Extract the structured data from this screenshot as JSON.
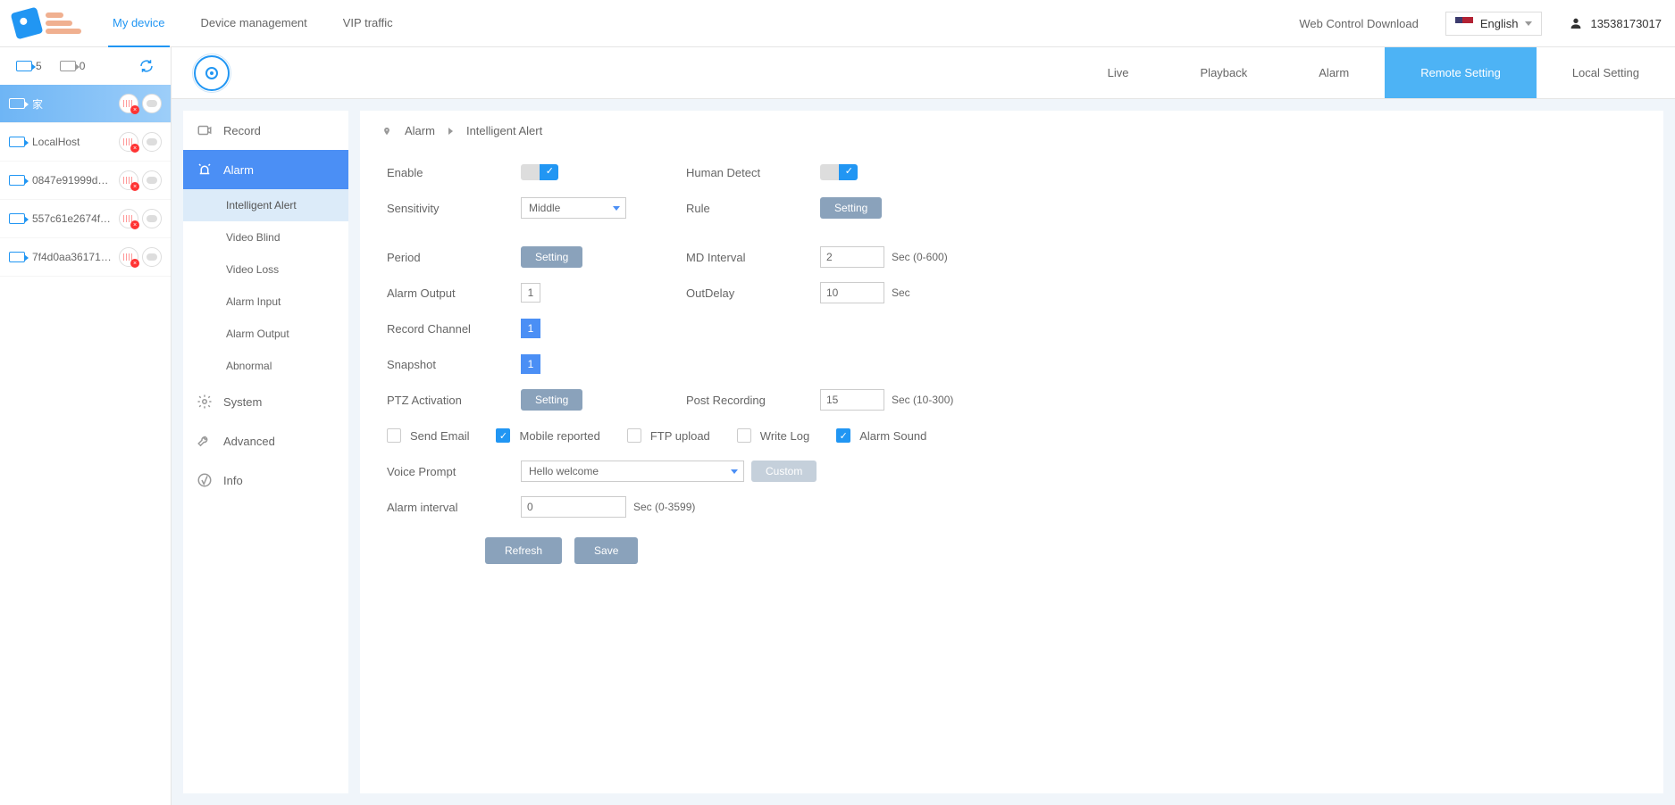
{
  "header": {
    "nav": {
      "my_device": "My device",
      "device_management": "Device management",
      "vip_traffic": "VIP traffic"
    },
    "web_control": "Web Control Download",
    "language": "English",
    "username": "13538173017"
  },
  "device_sidebar": {
    "count_on": "5",
    "count_off": "0",
    "devices": [
      {
        "name": "家"
      },
      {
        "name": "LocalHost"
      },
      {
        "name": "0847e91999d5..."
      },
      {
        "name": "557c61e2674ff..."
      },
      {
        "name": "7f4d0aa361710..."
      }
    ]
  },
  "sub_tabs": {
    "live": "Live",
    "playback": "Playback",
    "alarm": "Alarm",
    "remote_setting": "Remote Setting",
    "local_setting": "Local Setting"
  },
  "settings_nav": {
    "record": "Record",
    "alarm": "Alarm",
    "alarm_children": {
      "intelligent_alert": "Intelligent Alert",
      "video_blind": "Video Blind",
      "video_loss": "Video Loss",
      "alarm_input": "Alarm Input",
      "alarm_output": "Alarm Output",
      "abnormal": "Abnormal"
    },
    "system": "System",
    "advanced": "Advanced",
    "info": "Info"
  },
  "breadcrumb": {
    "alarm": "Alarm",
    "intelligent_alert": "Intelligent Alert"
  },
  "form": {
    "labels": {
      "enable": "Enable",
      "human_detect": "Human Detect",
      "sensitivity": "Sensitivity",
      "rule": "Rule",
      "period": "Period",
      "md_interval": "MD Interval",
      "alarm_output": "Alarm Output",
      "out_delay": "OutDelay",
      "record_channel": "Record Channel",
      "snapshot": "Snapshot",
      "ptz_activation": "PTZ Activation",
      "post_recording": "Post Recording",
      "voice_prompt": "Voice Prompt",
      "alarm_interval": "Alarm interval"
    },
    "values": {
      "sensitivity": "Middle",
      "md_interval": "2",
      "md_interval_suffix": "Sec (0-600)",
      "alarm_output_ch": "1",
      "out_delay": "10",
      "out_delay_suffix": "Sec",
      "record_channel": "1",
      "snapshot": "1",
      "post_recording": "15",
      "post_recording_suffix": "Sec (10-300)",
      "voice_prompt": "Hello welcome",
      "alarm_interval": "0",
      "alarm_interval_suffix": "Sec (0-3599)"
    },
    "buttons": {
      "setting": "Setting",
      "custom": "Custom",
      "refresh": "Refresh",
      "save": "Save"
    },
    "checkboxes": {
      "send_email": "Send Email",
      "mobile_reported": "Mobile reported",
      "ftp_upload": "FTP upload",
      "write_log": "Write Log",
      "alarm_sound": "Alarm Sound"
    }
  }
}
